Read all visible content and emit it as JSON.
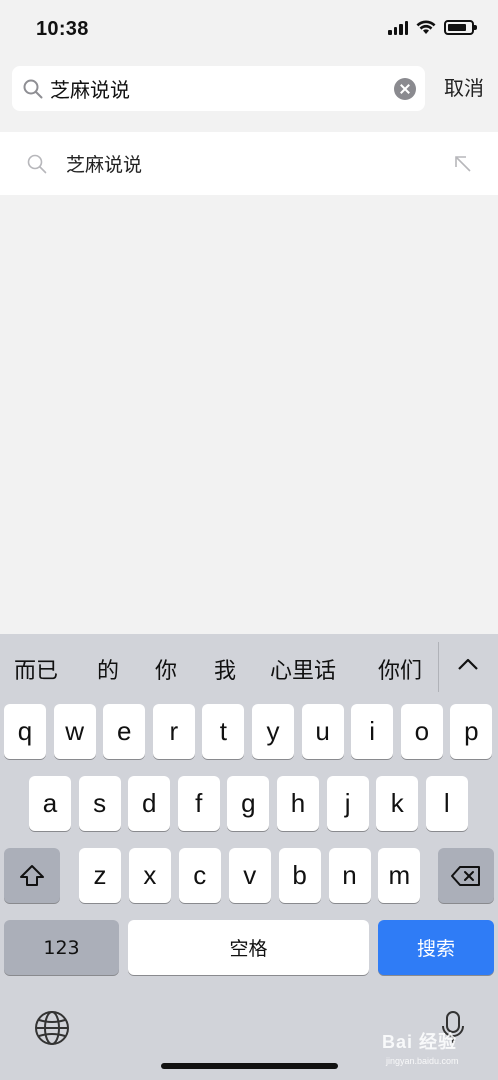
{
  "status_bar": {
    "time": "10:38",
    "signal_icon": "cellular-signal-icon",
    "wifi_icon": "wifi-icon",
    "battery_icon": "battery-icon"
  },
  "search": {
    "value": "芝麻说说",
    "placeholder": "",
    "search_icon": "search-icon",
    "clear_icon": "clear-icon",
    "cancel_label": "取消"
  },
  "suggestions": [
    {
      "text": "芝麻说说",
      "icon": "search-icon",
      "action_icon": "fill-query-arrow-icon"
    }
  ],
  "keyboard": {
    "candidates": [
      "而已",
      "的",
      "你",
      "我",
      "心里话",
      "你们"
    ],
    "expand_icon": "chevron-up-icon",
    "row1": [
      "q",
      "w",
      "e",
      "r",
      "t",
      "y",
      "u",
      "i",
      "o",
      "p"
    ],
    "row2": [
      "a",
      "s",
      "d",
      "f",
      "g",
      "h",
      "j",
      "k",
      "l"
    ],
    "row3": [
      "z",
      "x",
      "c",
      "v",
      "b",
      "n",
      "m"
    ],
    "shift_icon": "shift-icon",
    "delete_icon": "backspace-icon",
    "numbers_label": "123",
    "space_label": "空格",
    "search_label": "搜索",
    "globe_icon": "globe-icon",
    "mic_icon": "microphone-icon"
  },
  "watermark": {
    "text": "Bai 经验",
    "sub": "jingyan.baidu.com"
  },
  "colors": {
    "background": "#f2f2f2",
    "keyboard_bg": "#d1d3d9",
    "key_bg": "#ffffff",
    "dark_key_bg": "#abafb9",
    "accent": "#2f7cf6"
  }
}
